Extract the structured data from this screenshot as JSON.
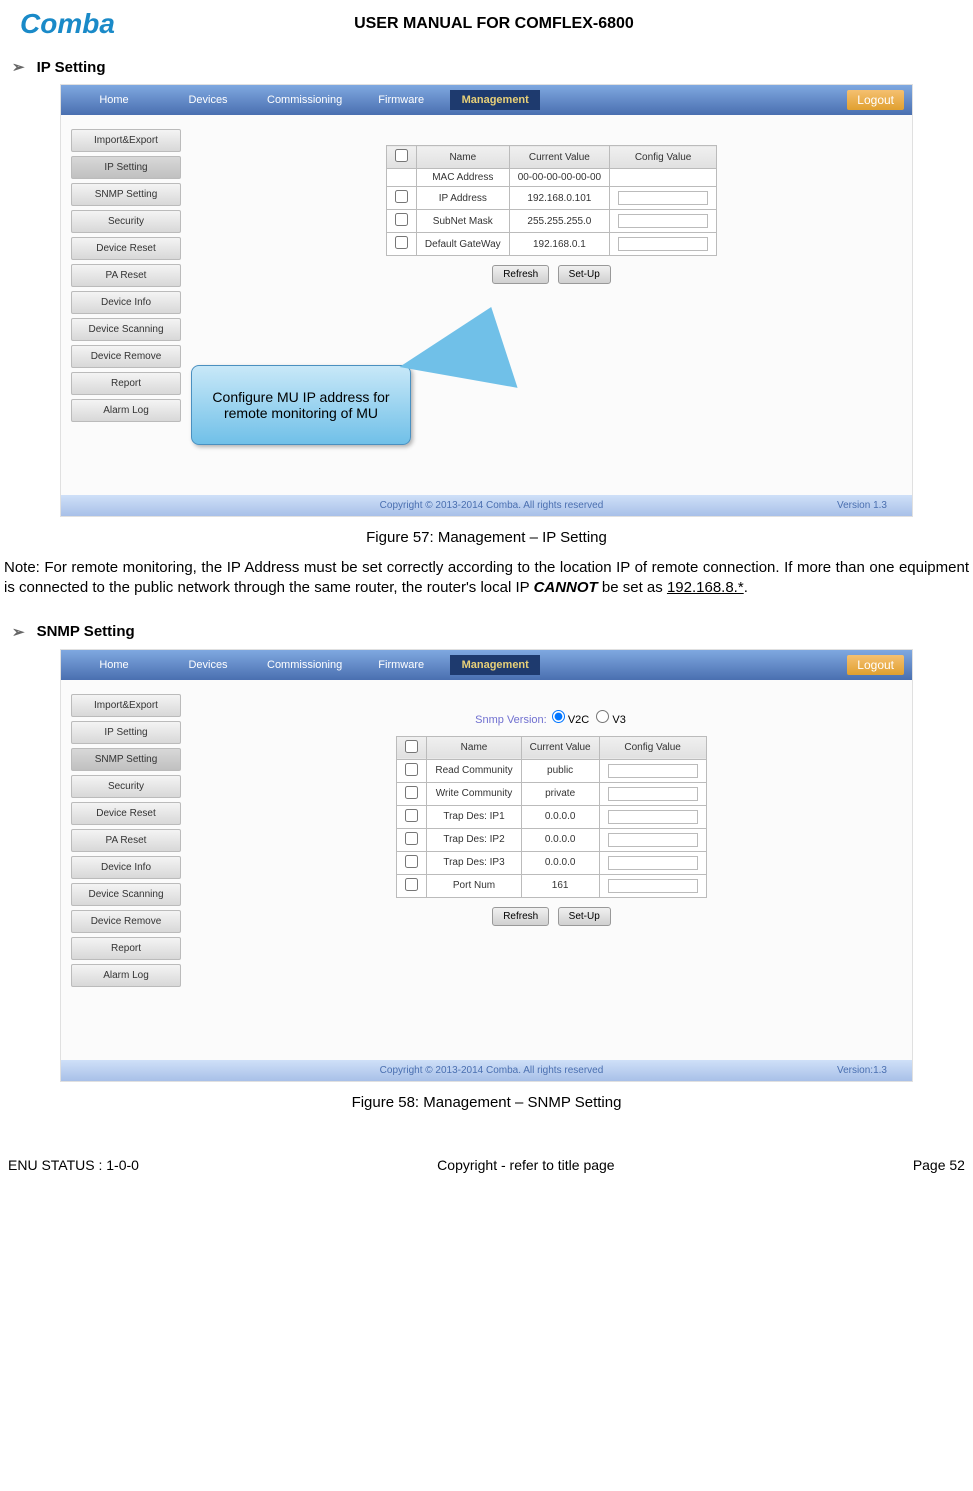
{
  "header": {
    "logo_text": "Comba",
    "doc_title": "USER MANUAL FOR COMFLEX-6800"
  },
  "section1": {
    "chevron": "➢",
    "title": "IP Setting"
  },
  "screenshot1": {
    "nav": [
      "Home",
      "Devices",
      "Commissioning",
      "Firmware",
      "Management"
    ],
    "logout": "Logout",
    "sidebar": [
      "Import&Export",
      "IP Setting",
      "SNMP Setting",
      "Security",
      "Device Reset",
      "PA Reset",
      "Device Info",
      "Device Scanning",
      "Device Remove",
      "Report",
      "Alarm Log"
    ],
    "headers": {
      "chk": "",
      "name": "Name",
      "cur": "Current Value",
      "conf": "Config Value"
    },
    "rows": [
      {
        "name": "MAC Address",
        "cur": "00-00-00-00-00-00",
        "input": false
      },
      {
        "name": "IP Address",
        "cur": "192.168.0.101",
        "input": true
      },
      {
        "name": "SubNet Mask",
        "cur": "255.255.255.0",
        "input": true
      },
      {
        "name": "Default GateWay",
        "cur": "192.168.0.1",
        "input": true
      }
    ],
    "buttons": {
      "refresh": "Refresh",
      "setup": "Set-Up"
    },
    "callout": "Configure MU IP address for remote monitoring of MU",
    "footer": {
      "copy": "Copyright © 2013-2014 Comba. All rights reserved",
      "ver": "Version 1.3"
    }
  },
  "caption1": "Figure 57: Management – IP Setting",
  "note": {
    "pre": "Note: For remote monitoring, the IP Address must be set correctly according to the location IP of remote connection. If more than one equipment is connected to the public network through the same router, the router's local IP ",
    "bold": "CANNOT",
    "post": " be set as ",
    "underline": "192.168.8.*",
    "end": "."
  },
  "section2": {
    "chevron": "➢",
    "title": "SNMP Setting"
  },
  "screenshot2": {
    "nav": [
      "Home",
      "Devices",
      "Commissioning",
      "Firmware",
      "Management"
    ],
    "logout": "Logout",
    "sidebar": [
      "Import&Export",
      "IP Setting",
      "SNMP Setting",
      "Security",
      "Device Reset",
      "PA Reset",
      "Device Info",
      "Device Scanning",
      "Device Remove",
      "Report",
      "Alarm Log"
    ],
    "snmp_label": "Snmp Version:",
    "snmp_v2c": "V2C",
    "snmp_v3": "V3",
    "headers": {
      "chk": "",
      "name": "Name",
      "cur": "Current Value",
      "conf": "Config Value"
    },
    "rows": [
      {
        "name": "Read Community",
        "cur": "public"
      },
      {
        "name": "Write Community",
        "cur": "private"
      },
      {
        "name": "Trap Des: IP1",
        "cur": "0.0.0.0"
      },
      {
        "name": "Trap Des: IP2",
        "cur": "0.0.0.0"
      },
      {
        "name": "Trap Des: IP3",
        "cur": "0.0.0.0"
      },
      {
        "name": "Port Num",
        "cur": "161"
      }
    ],
    "buttons": {
      "refresh": "Refresh",
      "setup": "Set-Up"
    },
    "footer": {
      "copy": "Copyright © 2013-2014 Comba. All rights reserved",
      "ver": "Version:1.3"
    }
  },
  "caption2": "Figure 58: Management – SNMP Setting",
  "page_footer": {
    "left": "ENU STATUS : 1-0-0",
    "center": "Copyright - refer to title page",
    "right": "Page 52"
  }
}
